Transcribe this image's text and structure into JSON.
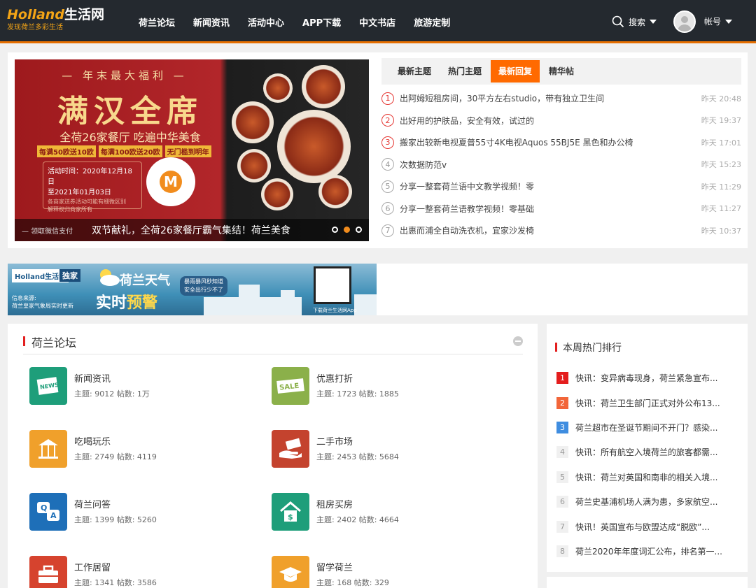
{
  "header": {
    "logo_brand": "Holland",
    "logo_title": "生活网",
    "logo_slogan": "发现荷兰多彩生活",
    "nav": [
      "荷兰论坛",
      "新闻资讯",
      "活动中心",
      "APP下载",
      "中文书店",
      "旅游定制"
    ],
    "search_label": "搜索",
    "account_label": "帐号"
  },
  "banner": {
    "top_text": "— 年末最大福利 —",
    "big_text": "满汉全席",
    "mid_text": "全荷26家餐厅  吃遍中华美食",
    "tags": [
      "每满50欧送10欧",
      "每满100欧送20欧",
      "无门槛到明年"
    ],
    "date_lines": [
      "活动时间：2020年12月18日",
      "至2021年01月03日",
      "各商家送券活动可能有细微区别",
      "解释权归商家所有"
    ],
    "qr_letter": "M",
    "caption_left": "— 领取微信支付",
    "caption": "双节献礼，全荷26家餐厅霸气集结！荷兰美食"
  },
  "topics": {
    "tabs": [
      "最新主题",
      "热门主题",
      "最新回复",
      "精华帖"
    ],
    "active_tab": 2,
    "items": [
      {
        "num": "1",
        "title": "出阿姆短租房间，30平方左右studio，带有独立卫生间",
        "time": "昨天 20:48"
      },
      {
        "num": "2",
        "title": "出好用的护肤品，安全有效，试过的",
        "time": "昨天 19:37"
      },
      {
        "num": "3",
        "title": "搬家出较新电视夏普55寸4K电视Aquos 55BJ5E 黑色和办公椅",
        "time": "昨天 17:01"
      },
      {
        "num": "4",
        "title": "次数据防范v",
        "time": "昨天 15:23"
      },
      {
        "num": "5",
        "title": "分享一整套荷兰语中文教学视频！零",
        "time": "昨天 11:29"
      },
      {
        "num": "6",
        "title": "分享一整套荷兰语教学视频！零基础",
        "time": "昨天 11:27"
      },
      {
        "num": "7",
        "title": "出惠而浦全自动洗衣机，宜家沙发椅",
        "time": "昨天 10:37"
      }
    ]
  },
  "ad": {
    "logo": "Holland生活网",
    "exclusive": "独家",
    "source": [
      "信息来源:",
      "荷兰皇家气象局实时更新"
    ],
    "title1": "荷兰天气",
    "title2a": "实时",
    "title2b": "预警",
    "bubble": [
      "暴雨暴风秒知道",
      "安全出行少不了"
    ],
    "download": "下载荷兰生活网App"
  },
  "forum": {
    "title": "荷兰论坛",
    "items": [
      {
        "name": "新闻资讯",
        "stats": "主题: 9012  帖数: 1万",
        "icon": "NEWS",
        "color": "#1e9e7a"
      },
      {
        "name": "优惠打折",
        "stats": "主题: 1723  帖数: 1885",
        "icon": "SALE",
        "color": "#8bb04a"
      },
      {
        "name": "吃喝玩乐",
        "stats": "主题: 2749  帖数: 4119",
        "icon": "carousel-icon",
        "color": "#f0a02b"
      },
      {
        "name": "二手市场",
        "stats": "主题: 2453  帖数: 5684",
        "icon": "money-hand-icon",
        "color": "#c4432e"
      },
      {
        "name": "荷兰问答",
        "stats": "主题: 1399  帖数: 5260",
        "icon": "qa-icon",
        "color": "#1e6fb8"
      },
      {
        "name": "租房买房",
        "stats": "主题: 2402  帖数: 4664",
        "icon": "house-icon",
        "color": "#1e9e7a"
      },
      {
        "name": "工作居留",
        "stats": "主题: 1341  帖数: 3586",
        "icon": "briefcase-icon",
        "color": "#d6432e"
      },
      {
        "name": "留学荷兰",
        "stats": "主题: 168  帖数: 329",
        "icon": "graduation-icon",
        "color": "#f0a02b"
      }
    ]
  },
  "hot": {
    "title": "本周热门排行",
    "items": [
      "快讯：变异病毒现身，荷兰紧急宣布...",
      "快讯：荷兰卫生部门正式对外公布13...",
      "荷兰超市在圣诞节期间不开门？感染...",
      "快讯：所有航空入境荷兰的旅客都需...",
      "快讯：荷兰对英国和南非的相关入境...",
      "荷兰史基浦机场人满为患，多家航空...",
      "快讯！英国宣布与欧盟达成“脱欧”...",
      "荷兰2020年年度词汇公布，排名第一..."
    ]
  }
}
